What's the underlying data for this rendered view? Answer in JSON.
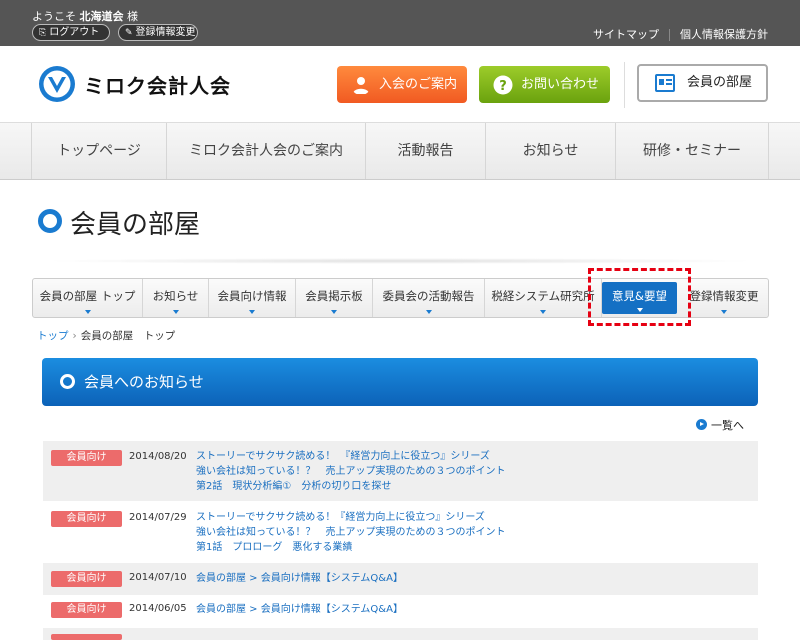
{
  "topbar": {
    "welcome_prefix": "ようこそ",
    "user_name": "北海道会",
    "honorific": "様",
    "logout_label": "ログアウト",
    "edit_label": "登録情報変更",
    "links": [
      "サイトマップ",
      "個人情報保護方針"
    ]
  },
  "header": {
    "logo_text": "ミロク会計人会",
    "join_label": "入会のご案内",
    "contact_label": "お問い合わせ",
    "member_label": "会員の部屋"
  },
  "global_nav": [
    "トップページ",
    "ミロク会計人会のご案内",
    "活動報告",
    "お知らせ",
    "研修・セミナー"
  ],
  "page_title": "会員の部屋",
  "sub_nav": [
    {
      "label": "会員の部屋 トップ",
      "active": false
    },
    {
      "label": "お知らせ",
      "active": false
    },
    {
      "label": "会員向け情報",
      "active": false
    },
    {
      "label": "会員掲示板",
      "active": false
    },
    {
      "label": "委員会の活動報告",
      "active": false
    },
    {
      "label": "税経システム研究所",
      "active": false
    },
    {
      "label": "意見&要望",
      "active": true
    },
    {
      "label": "登録情報変更",
      "active": false
    }
  ],
  "breadcrumb": {
    "home": "トップ",
    "current": "会員の部屋　トップ"
  },
  "notice": {
    "title": "会員へのお知らせ",
    "more_label": "一覧へ",
    "items": [
      {
        "tag": "会員向け",
        "date": "2014/08/20",
        "lines": [
          "ストーリーでサクサク読める！　『経営力向上に役立つ』シリーズ",
          "強い会社は知っている！？　売上アップ実現のための３つのポイント",
          "第2話　現状分析編①　分析の切り口を探せ"
        ]
      },
      {
        "tag": "会員向け",
        "date": "2014/07/29",
        "lines": [
          "ストーリーでサクサク読める！『経営力向上に役立つ』シリーズ",
          "強い会社は知っている！？　売上アップ実現のための３つのポイント",
          "第1話　プロローグ　悪化する業績"
        ]
      },
      {
        "tag": "会員向け",
        "date": "2014/07/10",
        "lines": [
          "会員の部屋 > 会員向け情報【システムQ&A】"
        ]
      },
      {
        "tag": "会員向け",
        "date": "2014/06/05",
        "lines": [
          "会員の部屋 > 会員向け情報【システムQ&A】"
        ]
      }
    ]
  },
  "colors": {
    "accent": "#1a7bd0",
    "join": "#f15a22",
    "contact": "#6aa20e",
    "tag": "#ec6b6b",
    "highlight": "#e60012"
  }
}
